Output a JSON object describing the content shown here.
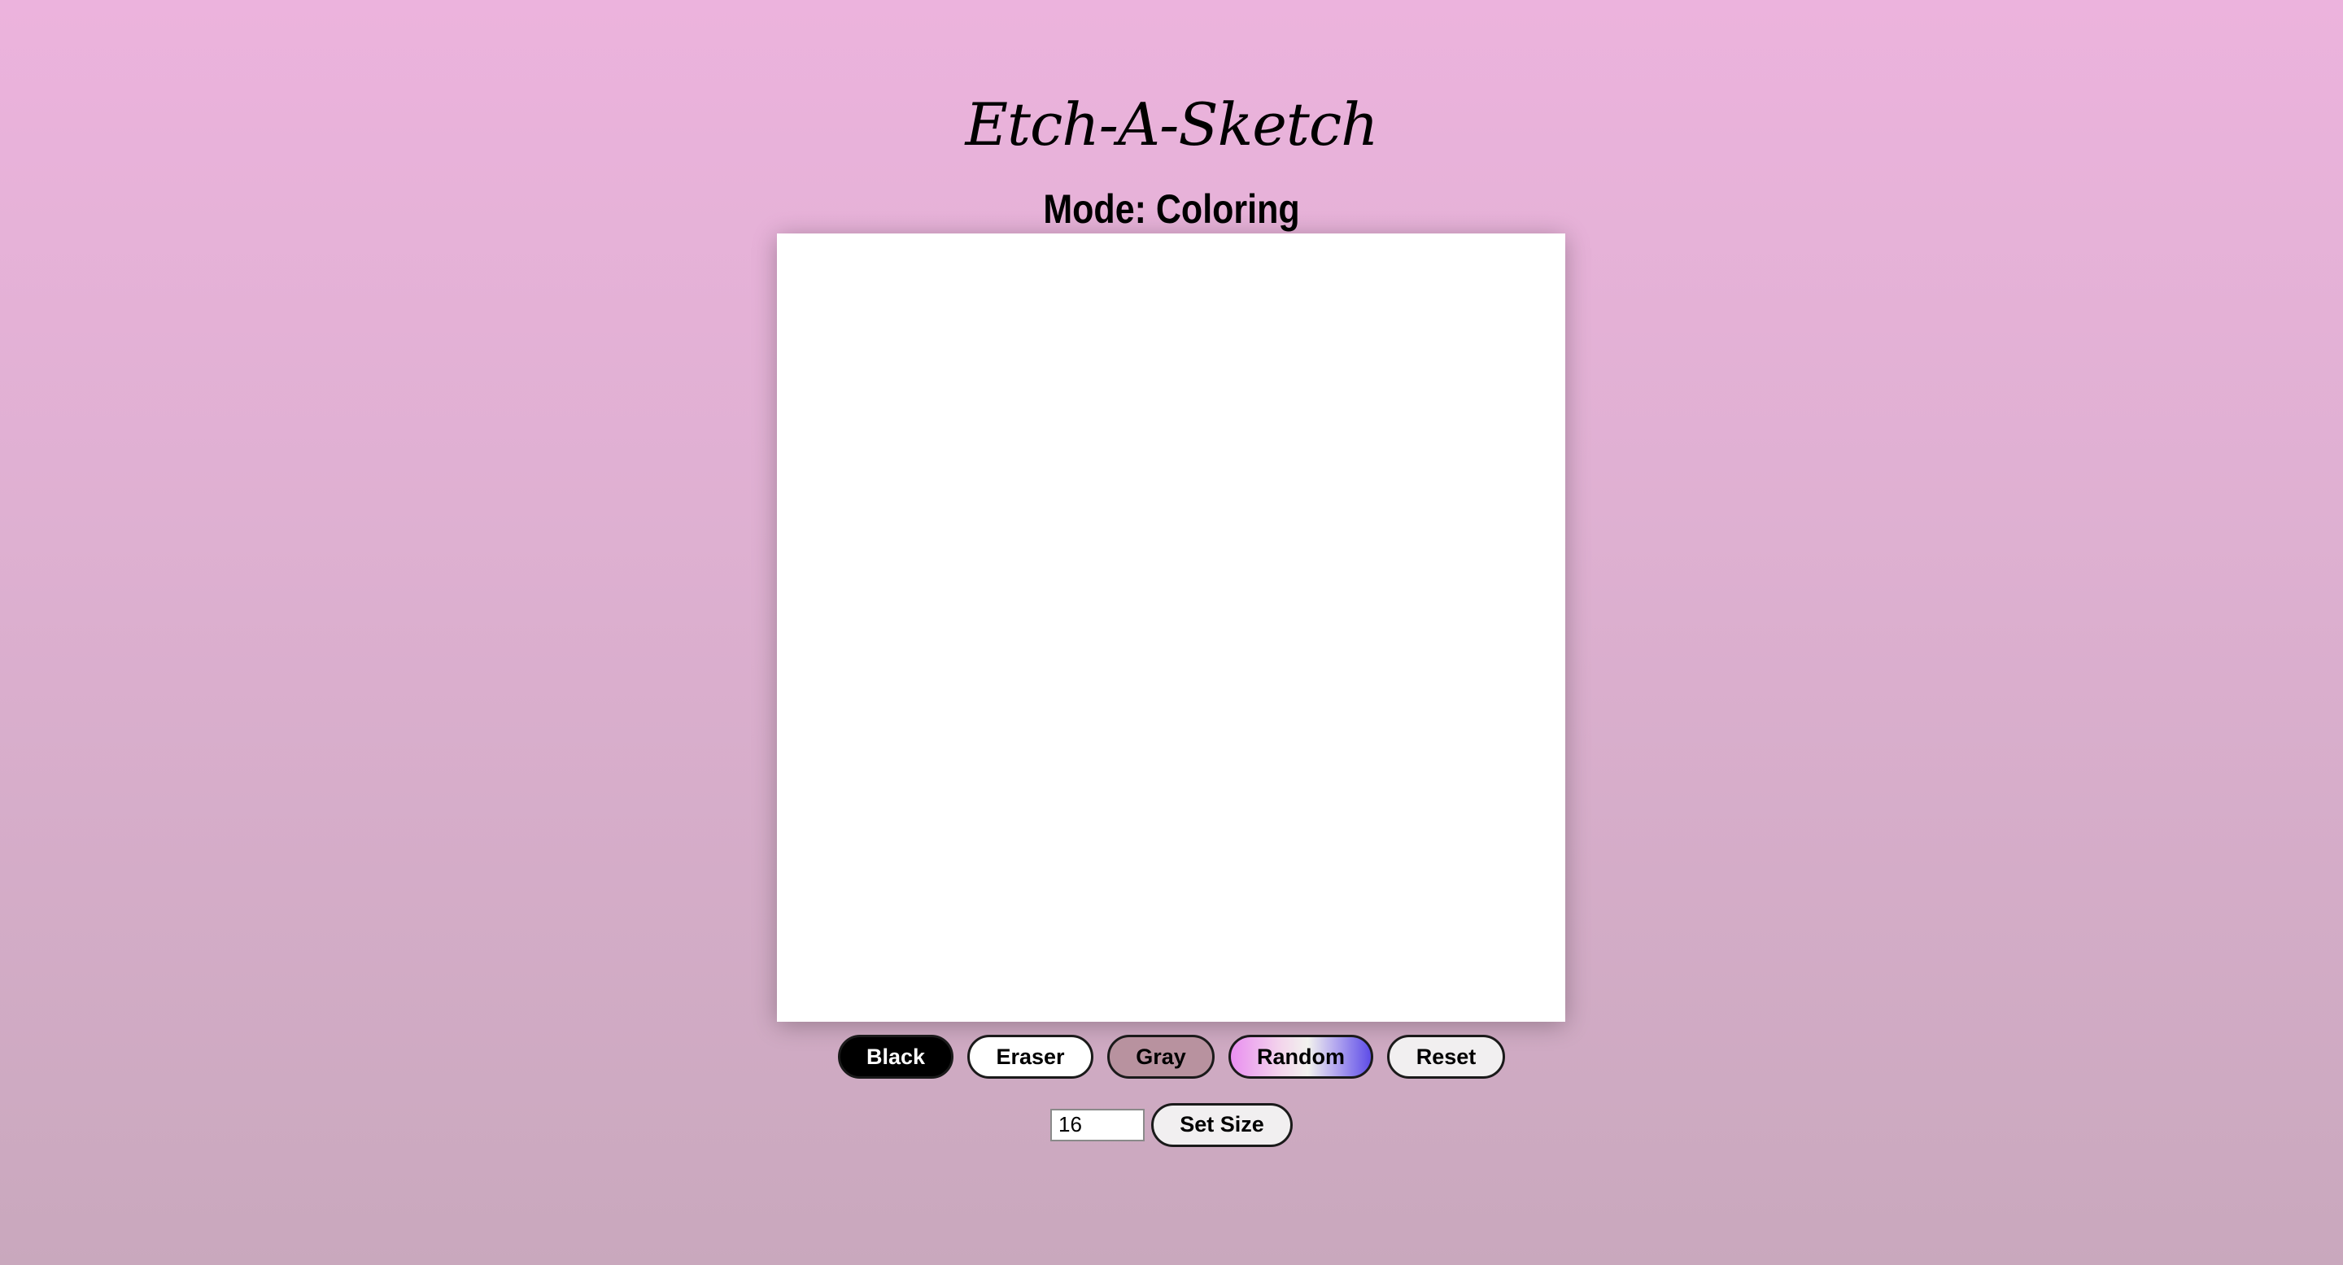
{
  "app": {
    "title": "Etch-A-Sketch",
    "mode_text": "Mode: Coloring"
  },
  "canvas": {
    "grid_size": 16,
    "background": "#ffffff"
  },
  "controls": {
    "black_label": "Black",
    "eraser_label": "Eraser",
    "gray_label": "Gray",
    "random_label": "Random",
    "reset_label": "Reset"
  },
  "size": {
    "input_value": "16",
    "set_size_label": "Set Size"
  },
  "colors": {
    "background_top": "#ecb3dd",
    "background_bottom": "#c9a8bd",
    "black_button": "#000000",
    "gray_button": "#b8929f",
    "random_gradient_start": "#e98ff0",
    "random_gradient_end": "#5e4de8"
  }
}
